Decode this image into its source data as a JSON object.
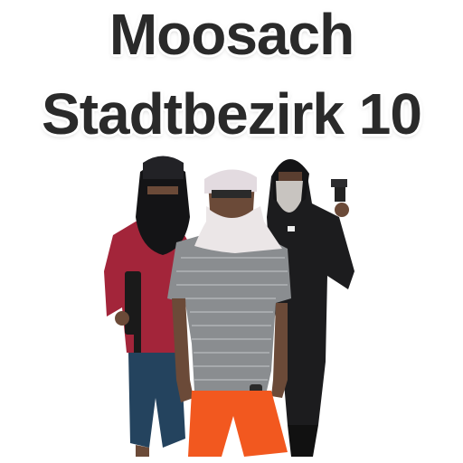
{
  "title": {
    "line1": "Moosach",
    "line2": "Stadtbezirk 10"
  },
  "photo": {
    "subject": "three-masked-men-photo"
  },
  "colors": {
    "text": "#2a2a2a",
    "outline": "#ffffff",
    "red_shirt": "#a3253a",
    "grey_shirt": "#8a8d90",
    "black_jacket": "#1c1c1e",
    "orange_shorts": "#f2581f",
    "blue_shorts": "#24435e",
    "skin": "#6b4a38"
  }
}
